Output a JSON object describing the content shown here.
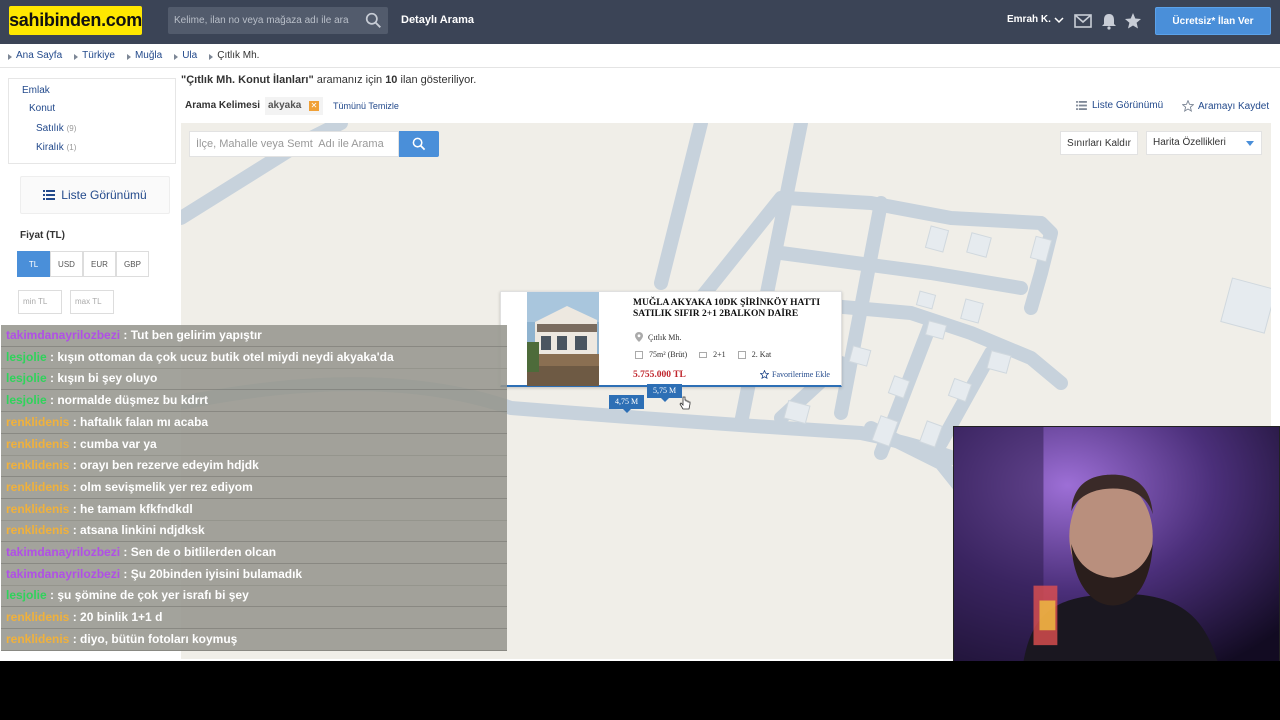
{
  "header": {
    "logo_text": "sahibinden.com",
    "search_placeholder": "Kelime, ilan no veya mağaza adı ile ara",
    "detailed_search": "Detaylı Arama",
    "user_name": "Emrah K.",
    "post_ad_button": "Ücretsiz* İlan Ver",
    "icons": [
      "search-icon",
      "chevron-down-icon",
      "mail-icon",
      "bell-icon",
      "star-icon"
    ],
    "colors": {
      "bar": "#3b4456",
      "logo_bg": "#ffe800",
      "post_btn": "#4a8fd9"
    }
  },
  "breadcrumb": [
    "Ana Sayfa",
    "Türkiye",
    "Muğla",
    "Ula",
    "Çıtlık Mh."
  ],
  "sidebar": {
    "categories": [
      {
        "label": "Emlak",
        "count": ""
      },
      {
        "label": "Konut",
        "count": ""
      },
      {
        "label": "Satılık",
        "count": "(9)"
      },
      {
        "label": "Kiralık",
        "count": "(1)"
      }
    ],
    "list_view_button": "Liste Görünümü",
    "price_label": "Fiyat (TL)",
    "currencies": [
      "TL",
      "USD",
      "EUR",
      "GBP"
    ],
    "active_currency": "TL",
    "min_placeholder": "min TL",
    "max_placeholder": "max TL"
  },
  "results": {
    "query": "\"Çıtlık Mh. Konut İlanları\"",
    "text_before_count": " aramanız için ",
    "count": "10",
    "text_after_count": " ilan gösteriliyor."
  },
  "keyword_bar": {
    "label": "Arama Kelimesi",
    "keyword": "akyaka",
    "clear_all": "Tümünü Temizle",
    "list_view_link": "Liste Görünümü",
    "save_search": "Aramayı Kaydet"
  },
  "map": {
    "search_placeholder": "İlçe, Mahalle veya Semt  Adı ile Arama",
    "remove_bounds": "Sınırları Kaldır",
    "map_features": "Harita Özellikleri",
    "popup": {
      "title": "MUĞLA AKYAKA 10DK ŞİRİNKÖY HATTI SATILIK SIFIR 2+1 2BALKON DAİRE",
      "location": "Çıtlık Mh.",
      "area": "75m² (Brüt)",
      "rooms": "2+1",
      "floor": "2. Kat",
      "price": "5.755.000 TL",
      "favorite": "Favorilerime Ekle"
    },
    "pins": [
      "4,75 M",
      "5,75 M"
    ]
  },
  "chat": [
    {
      "user": "takimdanayrilozbezi",
      "color": "#b04fe6",
      "msg": " : Tut ben gelirim yapıştır"
    },
    {
      "user": "lesjolie",
      "color": "#2fd35b",
      "msg": " : kışın ottoman da çok ucuz butik otel miydi neydi akyaka'da"
    },
    {
      "user": "lesjolie",
      "color": "#2fd35b",
      "msg": " : kışın bi şey oluyo"
    },
    {
      "user": "lesjolie",
      "color": "#2fd35b",
      "msg": " : normalde düşmez bu kdrrt"
    },
    {
      "user": "renklidenis",
      "color": "#f0b13c",
      "msg": " : haftalık falan mı acaba"
    },
    {
      "user": "renklidenis",
      "color": "#f0b13c",
      "msg": " : cumba var ya"
    },
    {
      "user": "renklidenis",
      "color": "#f0b13c",
      "msg": " : orayı ben rezerve edeyim hdjdk"
    },
    {
      "user": "renklidenis",
      "color": "#f0b13c",
      "msg": " : olm sevişmelik yer rez ediyom"
    },
    {
      "user": "renklidenis",
      "color": "#f0b13c",
      "msg": " : he tamam kfkfndkdl"
    },
    {
      "user": "renklidenis",
      "color": "#f0b13c",
      "msg": " : atsana linkini ndjdksk"
    },
    {
      "user": "takimdanayrilozbezi",
      "color": "#b04fe6",
      "msg": " : Sen de o bitlilerden olcan"
    },
    {
      "user": "takimdanayrilozbezi",
      "color": "#b04fe6",
      "msg": " : Şu 20binden iyisini bulamadık"
    },
    {
      "user": "lesjolie",
      "color": "#2fd35b",
      "msg": " : şu şömine de çok yer israfı bi şey"
    },
    {
      "user": "renklidenis",
      "color": "#f0b13c",
      "msg": " : 20 binlik 1+1 d"
    },
    {
      "user": "renklidenis",
      "color": "#f0b13c",
      "msg": " : diyo, bütün fotoları koymuş"
    }
  ]
}
